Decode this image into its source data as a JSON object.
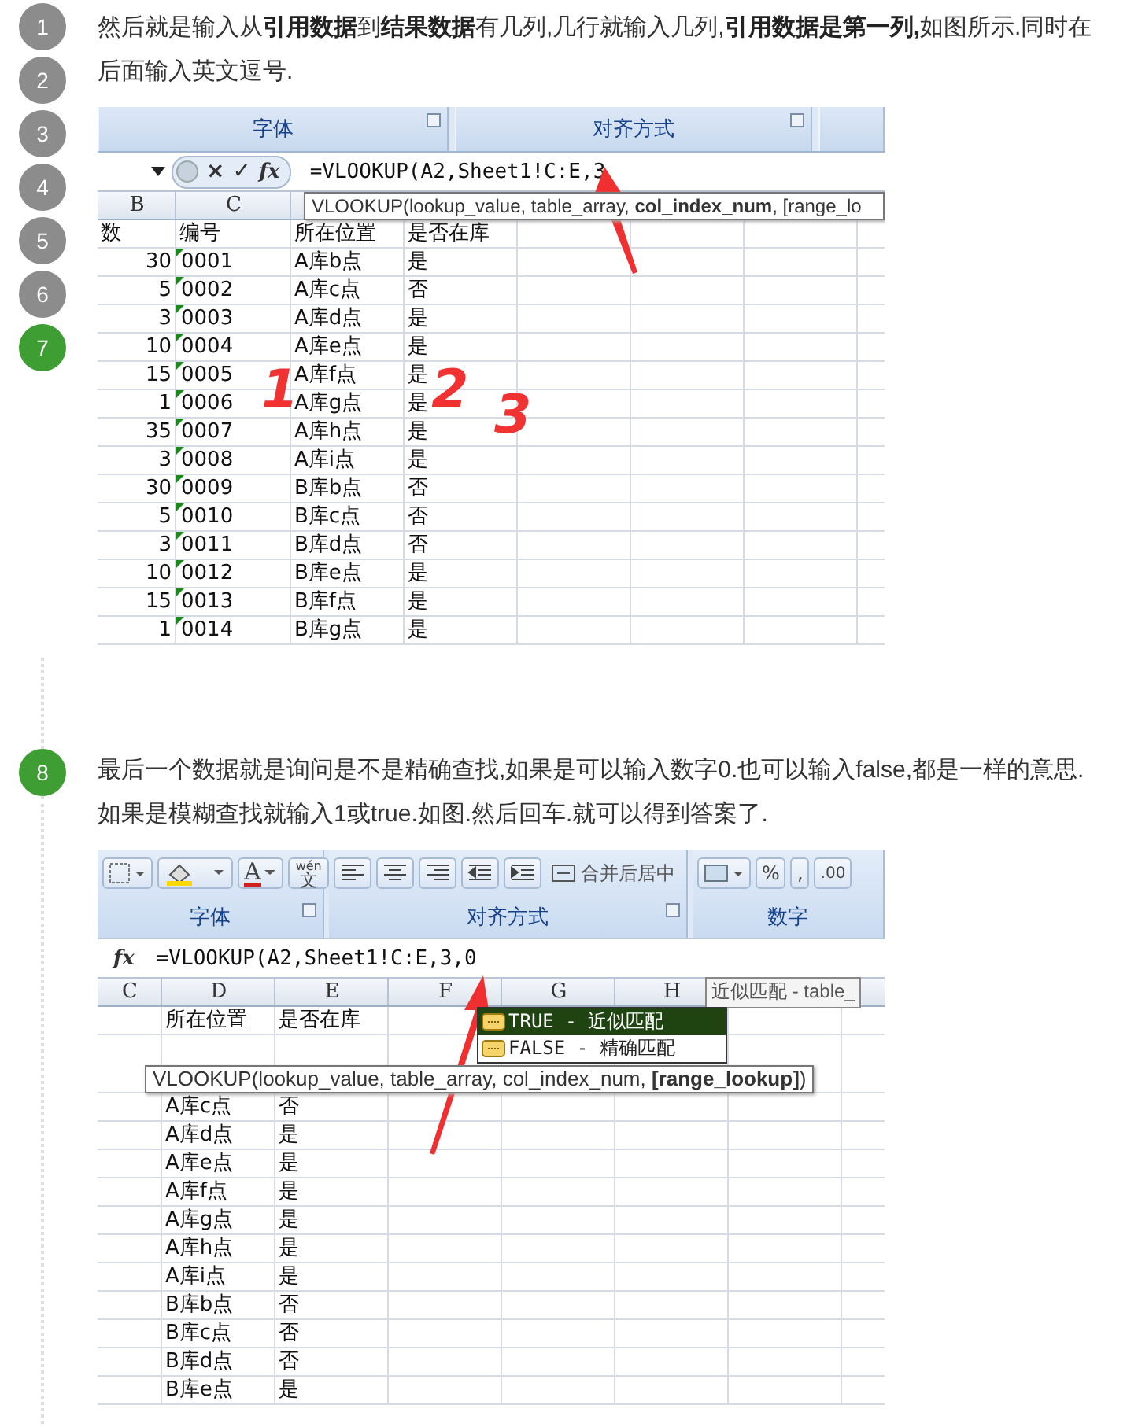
{
  "step_nav": [
    {
      "number": "1",
      "highlighted": false
    },
    {
      "number": "2",
      "highlighted": false
    },
    {
      "number": "3",
      "highlighted": false
    },
    {
      "number": "4",
      "highlighted": false
    },
    {
      "number": "5",
      "highlighted": false
    },
    {
      "number": "6",
      "highlighted": false
    },
    {
      "number": "7",
      "highlighted": true
    }
  ],
  "step_1": {
    "text": "然后就是输入从**引用数据**到**结果数据**有几列,几行就输入几列,**引用数据是第一列,**如图所示.同时在后面输入英文逗号.",
    "sheet": {
      "ribbon_groups": [
        "字体",
        "对齐方式"
      ],
      "formula_buttons": [
        "×",
        "✓",
        "fx"
      ],
      "formula": "=VLOOKUP(A2,Sheet1!C:E,3",
      "tooltip": "VLOOKUP(lookup_value, table_array, **col_index_num**, [range_lo",
      "column_headers": [
        "B",
        "C"
      ],
      "header_row": [
        "数",
        "编号",
        "所在位置",
        "是否在库"
      ],
      "rows": [
        [
          "30",
          "0001",
          "A库b点",
          "是"
        ],
        [
          "5",
          "0002",
          "A库c点",
          "否"
        ],
        [
          "3",
          "0003",
          "A库d点",
          "是"
        ],
        [
          "10",
          "0004",
          "A库e点",
          "是"
        ],
        [
          "15",
          "0005",
          "A库f点",
          "是"
        ],
        [
          "1",
          "0006",
          "A库g点",
          "是"
        ],
        [
          "35",
          "0007",
          "A库h点",
          "是"
        ],
        [
          "3",
          "0008",
          "A库i点",
          "是"
        ],
        [
          "30",
          "0009",
          "B库b点",
          "否"
        ],
        [
          "5",
          "0010",
          "B库c点",
          "否"
        ],
        [
          "3",
          "0011",
          "B库d点",
          "否"
        ],
        [
          "10",
          "0012",
          "B库e点",
          "是"
        ],
        [
          "15",
          "0013",
          "B库f点",
          "是"
        ],
        [
          "1",
          "0014",
          "B库g点",
          "是"
        ]
      ],
      "annotations": [
        "1",
        "2",
        "3"
      ]
    }
  },
  "step_2": {
    "number": "8",
    "highlighted": true,
    "text": "最后一个数据就是询问是不是精确查找,如果是可以输入数字0.也可以输入false,都是一样的意思.如果是模糊查找就输入1或true.如图.然后回车.就可以得到答案了.",
    "sheet": {
      "font_color_button": "A",
      "phonetic_button": {
        "ruby": "wén",
        "label": "文"
      },
      "merge_button": "合并后居中",
      "number_buttons": [
        "%",
        ","
      ],
      "decimal_button": ".00",
      "ribbon_groups": [
        "字体",
        "对齐方式",
        "数字"
      ],
      "formula_buttons": [
        "fx"
      ],
      "formula": "=VLOOKUP(A2,Sheet1!C:E,3,0",
      "column_headers": [
        "C",
        "D",
        "E",
        "F",
        "G",
        "H"
      ],
      "header_row": [
        "所在位置",
        "是否在库"
      ],
      "hint": "近似匹配 - table_",
      "autocomplete": [
        {
          "label": "TRUE - 近似匹配",
          "selected": true
        },
        {
          "label": "FALSE - 精确匹配",
          "selected": false
        }
      ],
      "tooltip": "VLOOKUP(lookup_value, table_array, col_index_num, **[range_lookup]**)",
      "rows": [
        [
          "A库c点",
          "否"
        ],
        [
          "A库d点",
          "是"
        ],
        [
          "A库e点",
          "是"
        ],
        [
          "A库f点",
          "是"
        ],
        [
          "A库g点",
          "是"
        ],
        [
          "A库h点",
          "是"
        ],
        [
          "A库i点",
          "是"
        ],
        [
          "B库b点",
          "否"
        ],
        [
          "B库c点",
          "否"
        ],
        [
          "B库d点",
          "否"
        ],
        [
          "B库e点",
          "是"
        ]
      ]
    }
  }
}
